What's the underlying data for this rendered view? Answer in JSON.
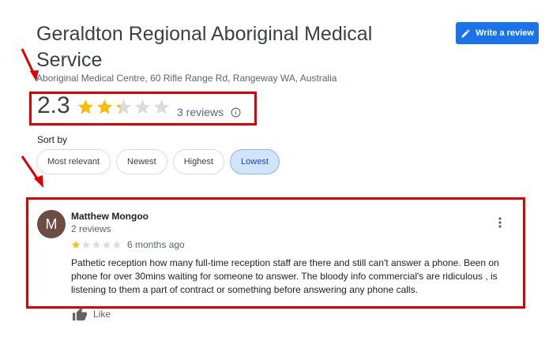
{
  "header": {
    "title": "Geraldton Regional Aboriginal Medical Service",
    "address": "Aboriginal Medical Centre, 60 Rifle Range Rd, Rangeway WA, Australia",
    "write_review_label": "Write a review"
  },
  "rating": {
    "value": "2.3",
    "stars_filled": 2.3,
    "reviews_label": "3 reviews"
  },
  "sort": {
    "label": "Sort by",
    "options": [
      "Most relevant",
      "Newest",
      "Highest",
      "Lowest"
    ],
    "selected": "Lowest"
  },
  "review": {
    "avatar_letter": "M",
    "author": "Matthew Mongoo",
    "author_meta": "2 reviews",
    "stars": 1,
    "time": "6 months ago",
    "text": "Pathetic reception how many full-time reception staff are there and still can't answer a phone.  Been on phone for over 30mins waiting for someone to answer.  The bloody info commercial's  are ridiculous , is listening to them a part of contract or something before answering any phone calls.",
    "like_label": "Like"
  },
  "colors": {
    "accent": "#1a73e8",
    "star": "#fbbc04",
    "star_empty": "#dadce0",
    "highlight_box": "#e00000",
    "avatar_bg": "#6d4c41"
  }
}
